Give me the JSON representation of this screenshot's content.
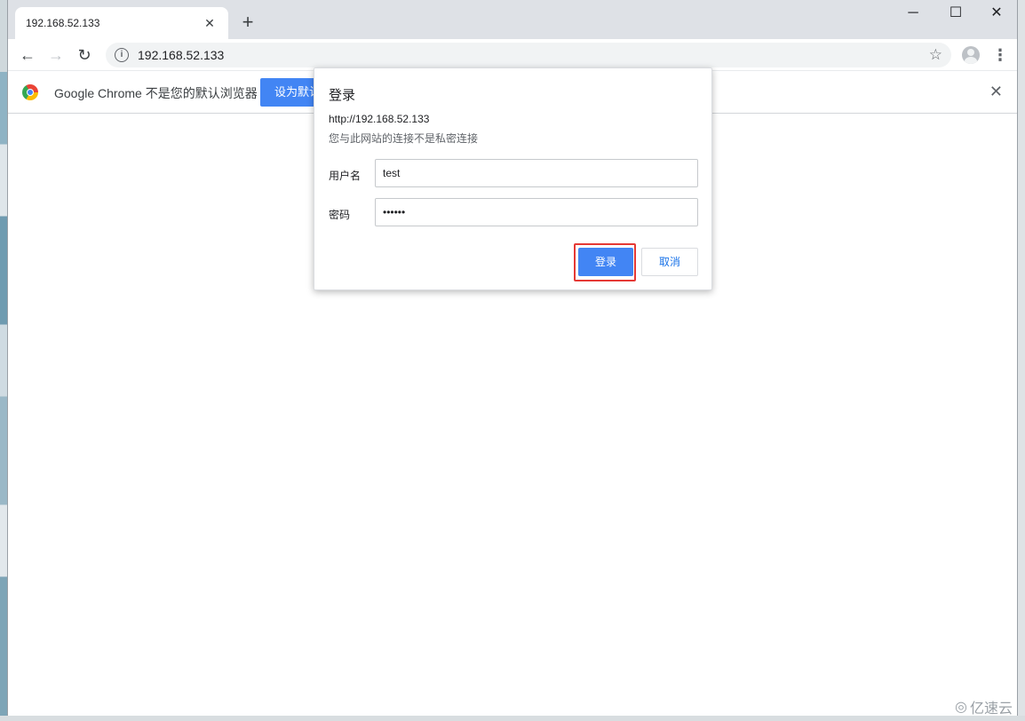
{
  "tab": {
    "title": "192.168.52.133",
    "close": "✕",
    "new_tab": "+"
  },
  "window_controls": {
    "minimize": "─",
    "maximize": "☐",
    "close": "✕"
  },
  "toolbar": {
    "back": "←",
    "forward": "→",
    "reload": "↻",
    "url": "192.168.52.133",
    "info_icon": "i",
    "bookmark_icon": "☆",
    "menu_icon": "⋮"
  },
  "infobar": {
    "text": "Google Chrome 不是您的默认浏览器",
    "button_label": "设为默认",
    "close": "✕"
  },
  "dialog": {
    "title": "登录",
    "url": "http://192.168.52.133",
    "warning": "您与此网站的连接不是私密连接",
    "username_label": "用户名",
    "username_value": "test",
    "password_label": "密码",
    "password_value": "••••••",
    "login_button": "登录",
    "cancel_button": "取消"
  },
  "watermark": {
    "logo": "◎",
    "text": "亿速云"
  },
  "colors": {
    "accent": "#4285f4",
    "highlight": "#e53935",
    "tabstrip": "#dee1e6"
  }
}
